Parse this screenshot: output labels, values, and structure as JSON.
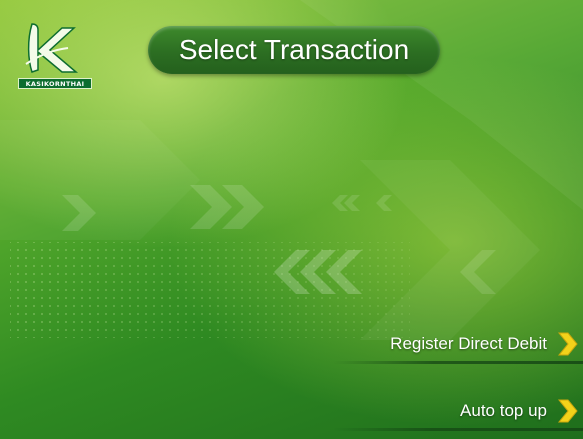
{
  "header": {
    "logo_text": "KASIKORNTHAI",
    "title": "Select Transaction"
  },
  "options": [
    {
      "label": "Register Direct Debit",
      "icon": "chevron-right-icon"
    },
    {
      "label": "Auto top up",
      "icon": "chevron-right-icon"
    }
  ],
  "colors": {
    "background": "#4ea42a",
    "title_pill": "#2c6e22",
    "chevron": "#f2d21a",
    "text": "#ffffff"
  }
}
